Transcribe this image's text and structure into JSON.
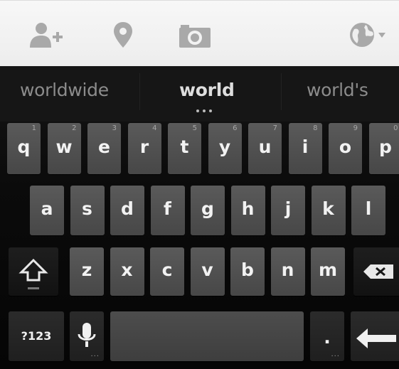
{
  "toolbar": {
    "icons": [
      "add-contact-icon",
      "location-pin-icon",
      "camera-icon",
      "globe-icon"
    ]
  },
  "suggestions": {
    "left": "worldwide",
    "center": "world",
    "right": "world's"
  },
  "keyboard": {
    "row1": [
      {
        "label": "q",
        "hint": "1"
      },
      {
        "label": "w",
        "hint": "2"
      },
      {
        "label": "e",
        "hint": "3"
      },
      {
        "label": "r",
        "hint": "4"
      },
      {
        "label": "t",
        "hint": "5"
      },
      {
        "label": "y",
        "hint": "6"
      },
      {
        "label": "u",
        "hint": "7"
      },
      {
        "label": "i",
        "hint": "8"
      },
      {
        "label": "o",
        "hint": "9"
      },
      {
        "label": "p",
        "hint": "0"
      }
    ],
    "row2": [
      "a",
      "s",
      "d",
      "f",
      "g",
      "h",
      "j",
      "k",
      "l"
    ],
    "row3": [
      "z",
      "x",
      "c",
      "v",
      "b",
      "n",
      "m"
    ],
    "symbols_label": "?123",
    "period_label": "."
  }
}
